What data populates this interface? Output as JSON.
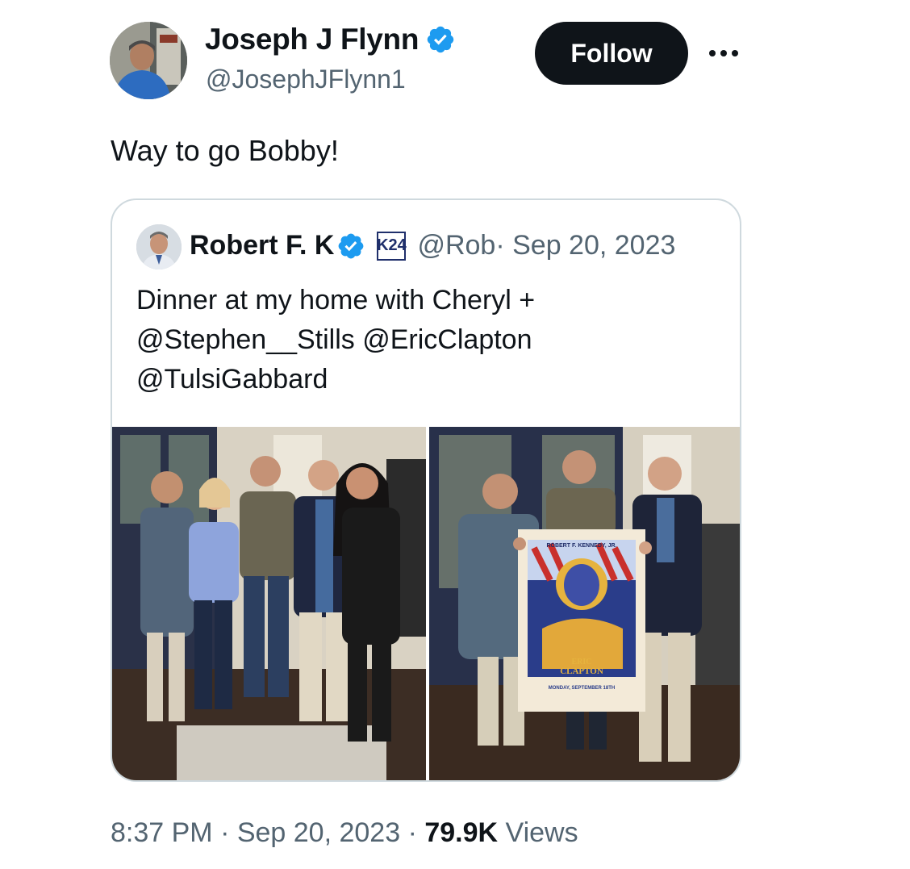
{
  "author": {
    "name": "Joseph J Flynn",
    "handle": "@JosephJFlynn1",
    "verified_color": "#1d9bf0"
  },
  "follow_label": "Follow",
  "more_icon": "more-horizontal-icon",
  "tweet_text": "Way to go Bobby!",
  "quoted": {
    "name": "Robert F. K",
    "badge_text": "K24",
    "handle": "@Rob",
    "date": "· Sep 20, 2023",
    "text_lines": [
      "Dinner at my home with Cheryl +",
      "@Stephen__Stills @EricClapton",
      "@TulsiGabbard"
    ]
  },
  "meta": {
    "time_date": "8:37 PM · Sep 20, 2023 · ",
    "views_count": "79.9K",
    "views_label": " Views"
  },
  "poster": {
    "top_text": "ROBERT F. KENNEDY, JR.",
    "name_top": "ERIC",
    "name_bottom": "CLAPTON",
    "bottom_text": "MONDAY, SEPTEMBER 18TH"
  }
}
